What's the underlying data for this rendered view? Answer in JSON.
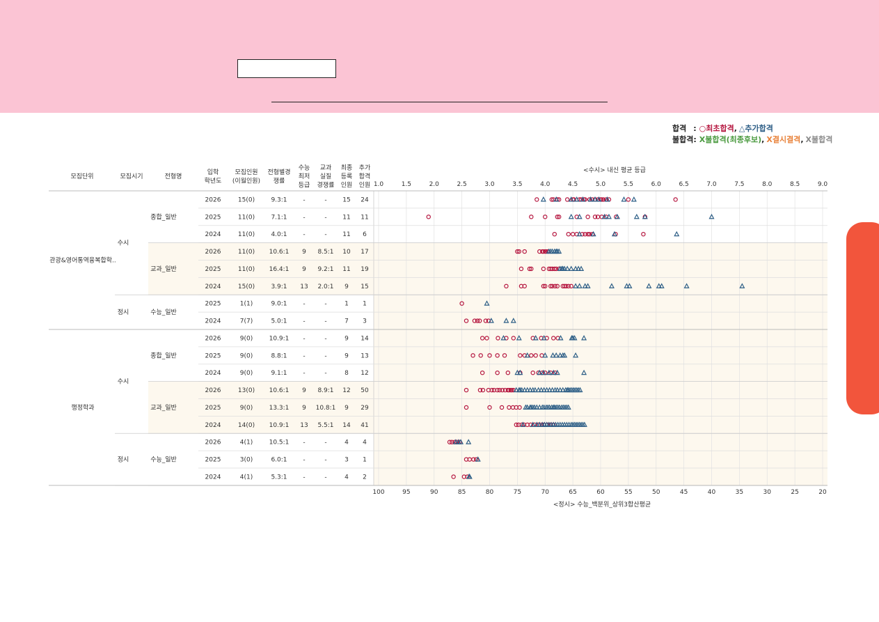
{
  "colors": {
    "header_bg": "#fbc4d4",
    "side_tab": "#f2553c",
    "row_shade": "#fdf8ee",
    "first_pass": "#b5163f",
    "extra_pass": "#2d5e86",
    "fail_waitlist": "#4a9a3f",
    "fail_absent": "#e8823a",
    "fail_other": "#8a8a8a",
    "grid": "#e2e2e2"
  },
  "legend": {
    "pass_label": "합격",
    "pass_sep": ":",
    "first_pass": "○최초합격",
    "extra_pass": "△추가합격",
    "fail_label": "불합격:",
    "fail_waitlist": "X불합격(최종후보)",
    "fail_absent": "X결시결격",
    "fail_other": "X불합격",
    "comma": ","
  },
  "table": {
    "headers": {
      "unit": "모집단위",
      "period": "모집시기",
      "type": "전형명",
      "year": [
        "입학",
        "학년도"
      ],
      "quota": [
        "모집인원",
        "(이월인원)"
      ],
      "ratio": [
        "전형별경",
        "쟁률"
      ],
      "min_grade": [
        "수능",
        "최저",
        "등급"
      ],
      "real_ratio": [
        "교과",
        "실질",
        "경쟁률"
      ],
      "registered": [
        "최종",
        "등록",
        "인원"
      ],
      "extra": [
        "추가",
        "합격",
        "인원"
      ]
    },
    "groups": [
      {
        "name": "관광&영어통역융복합학..",
        "periods": [
          {
            "name": "수시",
            "types": [
              {
                "name": "종합_일반",
                "rows": [
                  [
                    "2026",
                    "15(0)",
                    "9.3:1",
                    "-",
                    "-",
                    "15",
                    "24"
                  ],
                  [
                    "2025",
                    "11(0)",
                    "7.1:1",
                    "-",
                    "-",
                    "11",
                    "11"
                  ],
                  [
                    "2024",
                    "11(0)",
                    "4.0:1",
                    "-",
                    "-",
                    "11",
                    "6"
                  ]
                ]
              },
              {
                "name": "교과_일반",
                "rows": [
                  [
                    "2026",
                    "11(0)",
                    "10.6:1",
                    "9",
                    "8.5:1",
                    "10",
                    "17"
                  ],
                  [
                    "2025",
                    "11(0)",
                    "16.4:1",
                    "9",
                    "9.2:1",
                    "11",
                    "19"
                  ],
                  [
                    "2024",
                    "15(0)",
                    "3.9:1",
                    "13",
                    "2.0:1",
                    "9",
                    "15"
                  ]
                ]
              }
            ]
          },
          {
            "name": "정시",
            "types": [
              {
                "name": "수능_일반",
                "rows": [
                  [
                    "2025",
                    "1(1)",
                    "9.0:1",
                    "-",
                    "-",
                    "1",
                    "1"
                  ],
                  [
                    "2024",
                    "7(7)",
                    "5.0:1",
                    "-",
                    "-",
                    "7",
                    "3"
                  ]
                ]
              }
            ]
          }
        ]
      },
      {
        "name": "행정학과",
        "periods": [
          {
            "name": "수시",
            "types": [
              {
                "name": "종합_일반",
                "rows": [
                  [
                    "2026",
                    "9(0)",
                    "10.9:1",
                    "-",
                    "-",
                    "9",
                    "14"
                  ],
                  [
                    "2025",
                    "9(0)",
                    "8.8:1",
                    "-",
                    "-",
                    "9",
                    "13"
                  ],
                  [
                    "2024",
                    "9(0)",
                    "9.1:1",
                    "-",
                    "-",
                    "8",
                    "12"
                  ]
                ]
              },
              {
                "name": "교과_일반",
                "rows": [
                  [
                    "2026",
                    "13(0)",
                    "10.6:1",
                    "9",
                    "8.9:1",
                    "12",
                    "50"
                  ],
                  [
                    "2025",
                    "9(0)",
                    "13.3:1",
                    "9",
                    "10.8:1",
                    "9",
                    "29"
                  ],
                  [
                    "2024",
                    "14(0)",
                    "10.9:1",
                    "13",
                    "5.5:1",
                    "14",
                    "41"
                  ]
                ]
              }
            ]
          },
          {
            "name": "정시",
            "types": [
              {
                "name": "수능_일반",
                "rows": [
                  [
                    "2026",
                    "4(1)",
                    "10.5:1",
                    "-",
                    "-",
                    "4",
                    "4"
                  ],
                  [
                    "2025",
                    "3(0)",
                    "6.0:1",
                    "-",
                    "-",
                    "3",
                    "1"
                  ],
                  [
                    "2024",
                    "4(1)",
                    "5.3:1",
                    "-",
                    "-",
                    "4",
                    "2"
                  ]
                ]
              }
            ]
          }
        ]
      }
    ]
  },
  "chart_data": {
    "type": "scatter",
    "top_axis_label": "<수시> 내신 평균 등급",
    "bottom_axis_label": "<정시> 수능_백분위_상위3합산평균",
    "top_ticks": [
      "1.0",
      "1.5",
      "2.0",
      "2.5",
      "3.0",
      "3.5",
      "4.0",
      "4.5",
      "5.0",
      "5.5",
      "6.0",
      "6.5",
      "7.0",
      "7.5",
      "8.0",
      "8.5",
      "9.0"
    ],
    "bottom_ticks": [
      "100",
      "95",
      "90",
      "85",
      "80",
      "75",
      "70",
      "65",
      "60",
      "55",
      "50",
      "45",
      "40",
      "35",
      "30",
      "25",
      "20"
    ],
    "top_range": [
      1.0,
      9.0
    ],
    "bottom_range": [
      100,
      20
    ],
    "rows": [
      {
        "axis": "grade",
        "first": [
          3.85,
          4.12,
          4.15,
          4.22,
          4.25,
          4.4,
          4.5,
          4.52,
          4.62,
          4.65,
          4.7,
          4.72,
          4.8,
          4.85,
          4.9,
          4.95,
          5.0,
          5.02,
          5.05,
          5.1,
          5.15,
          5.5,
          6.35
        ],
        "extra": [
          3.97,
          4.2,
          4.47,
          4.57,
          4.68,
          4.82,
          4.9,
          4.97,
          5.12,
          5.42,
          5.6
        ]
      },
      {
        "axis": "grade",
        "first": [
          1.9,
          3.75,
          4.0,
          4.22,
          4.25,
          4.57,
          4.77,
          4.9,
          4.95,
          5.02,
          5.1,
          5.28,
          5.8
        ],
        "extra": [
          4.47,
          4.62,
          5.07,
          5.15,
          5.3,
          5.65,
          5.8,
          7.0
        ]
      },
      {
        "axis": "grade",
        "first": [
          4.17,
          4.42,
          4.5,
          4.57,
          4.67,
          4.72,
          4.77,
          4.8,
          4.85,
          5.27,
          5.77
        ],
        "extra": [
          4.62,
          4.87,
          5.25,
          6.37
        ]
      },
      {
        "axis": "grade",
        "first": [
          3.5,
          3.53,
          3.63,
          3.9,
          3.95,
          3.97,
          4.0,
          4.02,
          4.05
        ],
        "extra": [
          4.07,
          4.1,
          4.13,
          4.17,
          4.2,
          4.22,
          4.25
        ]
      },
      {
        "axis": "grade",
        "first": [
          3.57,
          3.72,
          3.75,
          3.97,
          4.07,
          4.1,
          4.13,
          4.17,
          4.2,
          4.25
        ],
        "extra": [
          4.27,
          4.3,
          4.32,
          4.35,
          4.4,
          4.47,
          4.55,
          4.6,
          4.65
        ]
      },
      {
        "axis": "grade",
        "first": [
          3.3,
          3.57,
          3.63,
          3.97,
          4.0,
          4.1,
          4.13,
          4.18,
          4.22,
          4.32,
          4.35,
          4.38,
          4.42,
          4.47
        ],
        "extra": [
          4.55,
          4.62,
          4.72,
          4.77,
          5.2,
          5.47,
          5.52,
          5.87,
          6.05,
          6.1,
          6.55,
          7.55
        ]
      },
      {
        "axis": "score",
        "first": [
          85.0
        ],
        "extra": [
          80.5
        ]
      },
      {
        "axis": "score",
        "first": [
          84.2,
          82.7,
          82.2,
          81.8,
          80.7,
          80.2
        ],
        "extra": [
          79.7,
          77.0,
          75.7
        ]
      },
      {
        "axis": "score",
        "first": [
          81.3,
          80.5,
          78.5,
          77.0,
          75.7,
          72.2,
          70.7,
          69.7,
          68.5,
          67.7
        ],
        "extra": [
          77.5,
          74.7,
          71.7,
          70.2,
          67.2,
          65.2,
          65.0,
          64.7,
          63.0
        ]
      },
      {
        "axis": "score",
        "first": [
          83.0,
          81.6,
          80.0,
          78.6,
          77.3,
          74.5,
          73.7,
          72.5,
          71.7,
          70.6
        ],
        "extra": [
          73.2,
          70.0,
          68.6,
          68.0,
          67.3,
          66.8,
          66.5,
          64.5
        ]
      },
      {
        "axis": "score",
        "first": [
          81.3,
          78.6,
          76.7,
          74.5,
          72.2,
          71.2,
          70.5,
          70.0,
          69.0,
          68.2
        ],
        "extra": [
          75.0,
          74.5,
          71.0,
          70.3,
          69.3,
          68.5,
          67.8,
          63.0
        ]
      },
      {
        "axis": "score",
        "first": [
          84.2,
          81.7,
          81.2,
          80.2,
          79.6,
          79.2,
          78.6,
          78.2,
          77.7,
          77.2,
          76.7,
          76.5,
          76.2,
          76.0,
          75.7
        ],
        "extra": [
          75.2,
          74.7,
          74.5,
          74.2,
          73.7,
          73.2,
          72.7,
          72.2,
          71.8,
          71.2,
          70.7,
          70.2,
          69.7,
          69.2,
          68.7,
          68.2,
          67.8,
          67.3,
          66.8,
          66.3,
          66.0,
          65.8,
          65.5,
          65.2,
          64.9,
          64.6,
          64.3,
          64.0,
          63.7
        ]
      },
      {
        "axis": "score",
        "first": [
          84.2,
          80.0,
          77.8,
          76.5,
          75.8,
          75.2,
          74.6
        ],
        "extra": [
          73.5,
          73.2,
          72.7,
          72.5,
          72.2,
          71.9,
          71.5,
          71.0,
          70.5,
          70.2,
          69.8,
          69.5,
          69.2,
          68.8,
          68.5,
          68.3,
          68.0,
          67.7,
          67.4,
          67.0,
          66.7,
          66.4,
          66.1,
          65.8
        ]
      },
      {
        "axis": "score",
        "first": [
          75.2,
          74.8,
          74.2,
          73.8,
          73.2,
          72.6,
          71.9,
          71.2,
          70.6,
          70.2,
          69.6,
          69.0,
          68.5
        ],
        "extra": [
          74.0,
          72.2,
          71.5,
          71.0,
          70.5,
          70.1,
          69.7,
          69.3,
          68.9,
          68.5,
          68.1,
          67.7,
          67.3,
          66.9,
          66.5,
          66.1,
          65.7,
          65.3,
          65.0,
          64.7,
          64.4,
          64.1,
          63.8,
          63.5,
          63.2,
          62.9
        ]
      },
      {
        "axis": "score",
        "first": [
          87.2,
          86.8,
          86.3,
          85.9,
          85.4
        ],
        "extra": [
          86.1,
          85.6,
          85.2,
          83.8
        ]
      },
      {
        "axis": "score",
        "first": [
          84.2,
          83.6,
          82.9,
          82.4
        ],
        "extra": [
          82.1
        ]
      },
      {
        "axis": "score",
        "first": [
          86.5,
          84.6,
          84.0
        ],
        "extra": [
          83.7,
          83.6
        ]
      }
    ]
  }
}
